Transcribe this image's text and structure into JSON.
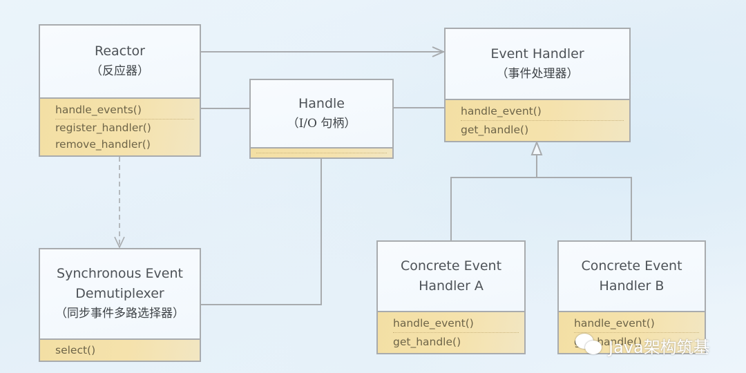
{
  "diagram": {
    "type": "UML class diagram - Reactor pattern",
    "classes": {
      "reactor": {
        "name": "Reactor",
        "name_cn": "（反应器）",
        "ops": [
          "handle_events()",
          "register_handler()",
          "remove_handler()"
        ]
      },
      "handle": {
        "name": "Handle",
        "name_cn": "（I/O 句柄）",
        "ops": []
      },
      "event_handler": {
        "name": "Event Handler",
        "name_cn": "（事件处理器）",
        "ops": [
          "handle_event()",
          "get_handle()"
        ]
      },
      "demux": {
        "name_line1": "Synchronous Event",
        "name_line2": "Demutiplexer",
        "name_cn": "（同步事件多路选择器）",
        "ops": [
          "select()"
        ]
      },
      "concrete_a": {
        "name_line1": "Concrete Event",
        "name_line2": "Handler A",
        "ops": [
          "handle_event()",
          "get_handle()"
        ]
      },
      "concrete_b": {
        "name_line1": "Concrete Event",
        "name_line2": "Handler B",
        "ops": [
          "handle_event()",
          "get_handle()"
        ]
      }
    },
    "relations": [
      {
        "from": "Reactor",
        "to": "Event Handler",
        "kind": "association-arrow"
      },
      {
        "from": "Reactor",
        "to": "Handle",
        "kind": "association"
      },
      {
        "from": "Handle",
        "to": "Event Handler",
        "kind": "association"
      },
      {
        "from": "Reactor",
        "to": "Synchronous Event Demutiplexer",
        "kind": "dependency-dashed-arrow"
      },
      {
        "from": "Handle",
        "to": "Synchronous Event Demutiplexer",
        "kind": "association"
      },
      {
        "from": "Concrete Event Handler A",
        "to": "Event Handler",
        "kind": "inheritance"
      },
      {
        "from": "Concrete Event Handler B",
        "to": "Event Handler",
        "kind": "inheritance"
      }
    ]
  },
  "watermark": {
    "icon": "wechat-icon",
    "text": "Java架构筑基"
  },
  "colors": {
    "border": "#a8abae",
    "ops_fill": "#f3dfa4",
    "background": "#e8f2f9"
  }
}
